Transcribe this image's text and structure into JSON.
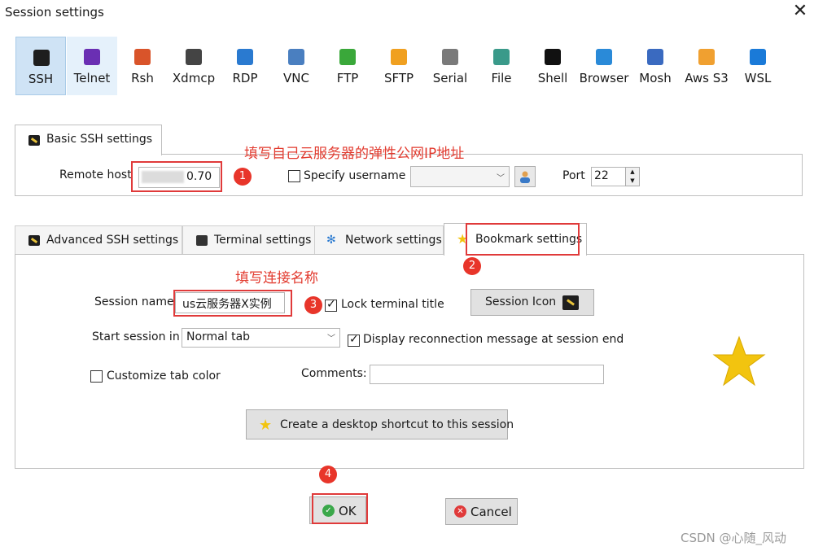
{
  "window": {
    "title": "Session settings"
  },
  "toolbar": [
    {
      "label": "SSH",
      "icon": "ssh-key-icon",
      "color": "#1e1e1e"
    },
    {
      "label": "Telnet",
      "icon": "telnet-icon",
      "color": "#6a2fb3"
    },
    {
      "label": "Rsh",
      "icon": "rsh-icon",
      "color": "#d9542a"
    },
    {
      "label": "Xdmcp",
      "icon": "xdmcp-icon",
      "color": "#444444"
    },
    {
      "label": "RDP",
      "icon": "rdp-icon",
      "color": "#2a7ad0"
    },
    {
      "label": "VNC",
      "icon": "vnc-icon",
      "color": "#4a7fc0"
    },
    {
      "label": "FTP",
      "icon": "ftp-icon",
      "color": "#3aa83a"
    },
    {
      "label": "SFTP",
      "icon": "sftp-icon",
      "color": "#f0a020"
    },
    {
      "label": "Serial",
      "icon": "serial-icon",
      "color": "#7a7a7a"
    },
    {
      "label": "File",
      "icon": "file-icon",
      "color": "#3a9a8a"
    },
    {
      "label": "Shell",
      "icon": "shell-icon",
      "color": "#111111"
    },
    {
      "label": "Browser",
      "icon": "browser-icon",
      "color": "#2a8ad8"
    },
    {
      "label": "Mosh",
      "icon": "mosh-icon",
      "color": "#3a6ac0"
    },
    {
      "label": "Aws S3",
      "icon": "aws-s3-icon",
      "color": "#f0a030"
    },
    {
      "label": "WSL",
      "icon": "wsl-icon",
      "color": "#1a7ad8"
    }
  ],
  "basic": {
    "tab_label": "Basic SSH settings",
    "remote_host_label": "Remote host",
    "remote_host_value": "0.70",
    "specify_username_label": "Specify username",
    "port_label": "Port",
    "port_value": "22"
  },
  "tabs": {
    "advanced": "Advanced SSH settings",
    "terminal": "Terminal settings",
    "network": "Network settings",
    "bookmark": "Bookmark settings"
  },
  "bookmark": {
    "session_name_label": "Session name:",
    "session_name_value": "us云服务器X实例",
    "lock_title_label": "Lock terminal title",
    "session_icon_button": "Session Icon",
    "start_session_label": "Start session in",
    "start_session_value": "Normal tab",
    "display_reconnect_label": "Display reconnection message at session end",
    "customize_tab_color_label": "Customize tab color",
    "comments_label": "Comments:",
    "shortcut_button": "Create a desktop shortcut to this session"
  },
  "footer": {
    "ok": "OK",
    "cancel": "Cancel"
  },
  "annotations": {
    "host_note": "填写自己云服务器的弹性公网IP地址",
    "name_note": "填写连接名称",
    "b1": "1",
    "b2": "2",
    "b3": "3",
    "b4": "4"
  },
  "watermark": "CSDN @心随_风动",
  "colors": {
    "annotation_red": "#e03a3a",
    "selected_tool": "#cfe3f5",
    "star": "#f2c40f"
  }
}
